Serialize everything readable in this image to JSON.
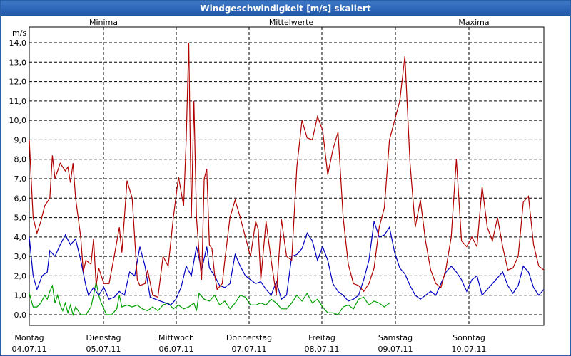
{
  "window": {
    "title": "Windgeschwindigkeit [m/s] skaliert"
  },
  "chart_data": {
    "type": "line",
    "title": "Windgeschwindigkeit [m/s] skaliert",
    "ylabel": "m/s",
    "ylim": [
      0,
      14
    ],
    "grid": true,
    "y_ticks": [
      "0,0",
      "1,0",
      "2,0",
      "3,0",
      "4,0",
      "5,0",
      "6,0",
      "7,0",
      "8,0",
      "9,0",
      "10,0",
      "11,0",
      "12,0",
      "13,0",
      "14,0"
    ],
    "x_ticks": [
      {
        "day": "Montag",
        "date": "04.07.11"
      },
      {
        "day": "Dienstag",
        "date": "05.07.11"
      },
      {
        "day": "Mittwoch",
        "date": "06.07.11"
      },
      {
        "day": "Donnerstag",
        "date": "07.07.11"
      },
      {
        "day": "Freitag",
        "date": "08.07.11"
      },
      {
        "day": "Samstag",
        "date": "09.07.11"
      },
      {
        "day": "Sonntag",
        "date": "10.07.11"
      }
    ],
    "x_range": [
      0,
      7
    ],
    "legend_placement": "top",
    "series": [
      {
        "name": "Minima",
        "color": "#00a000",
        "values": [
          [
            0.0,
            1.1
          ],
          [
            0.15,
            0.4
          ],
          [
            0.3,
            0.4
          ],
          [
            0.45,
            0.6
          ],
          [
            0.6,
            1.0
          ],
          [
            0.7,
            0.8
          ],
          [
            0.8,
            1.2
          ],
          [
            0.9,
            1.5
          ],
          [
            1.0,
            0.6
          ],
          [
            1.1,
            1.0
          ],
          [
            1.2,
            0.5
          ],
          [
            1.3,
            0.2
          ],
          [
            1.4,
            0.6
          ],
          [
            1.5,
            0.1
          ],
          [
            1.6,
            0.5
          ],
          [
            1.7,
            0.0
          ],
          [
            1.8,
            0.4
          ],
          [
            2.0,
            0.0
          ],
          [
            2.2,
            0.0
          ],
          [
            2.4,
            0.4
          ],
          [
            2.5,
            1.0
          ],
          [
            2.6,
            1.7
          ],
          [
            2.7,
            1.0
          ],
          [
            2.8,
            0.6
          ],
          [
            3.0,
            0.0
          ],
          [
            3.2,
            0.0
          ],
          [
            3.4,
            0.3
          ],
          [
            3.5,
            1.0
          ],
          [
            3.6,
            0.4
          ],
          [
            3.8,
            0.5
          ],
          [
            4.0,
            0.4
          ],
          [
            4.2,
            0.5
          ],
          [
            4.4,
            0.3
          ],
          [
            4.6,
            0.2
          ],
          [
            4.8,
            0.4
          ],
          [
            5.0,
            0.2
          ],
          [
            5.2,
            0.5
          ],
          [
            5.4,
            0.6
          ],
          [
            5.6,
            0.3
          ],
          [
            5.8,
            0.5
          ],
          [
            6.0,
            0.3
          ],
          [
            6.2,
            0.4
          ],
          [
            6.4,
            0.6
          ],
          [
            6.5,
            0.2
          ],
          [
            6.6,
            1.1
          ],
          [
            6.8,
            0.8
          ],
          [
            7.0,
            0.7
          ],
          [
            7.2,
            1.0
          ],
          [
            7.4,
            0.5
          ],
          [
            7.6,
            0.7
          ],
          [
            7.8,
            0.3
          ],
          [
            8.0,
            0.6
          ],
          [
            8.2,
            1.0
          ],
          [
            8.4,
            0.9
          ],
          [
            8.6,
            0.5
          ],
          [
            8.8,
            0.5
          ],
          [
            9.0,
            0.6
          ],
          [
            9.2,
            0.5
          ],
          [
            9.4,
            0.8
          ],
          [
            9.6,
            0.6
          ],
          [
            9.8,
            0.3
          ],
          [
            10.0,
            0.3
          ],
          [
            10.2,
            0.6
          ],
          [
            10.4,
            1.0
          ],
          [
            10.6,
            0.7
          ],
          [
            10.8,
            1.1
          ],
          [
            11.0,
            0.6
          ],
          [
            11.2,
            0.8
          ],
          [
            11.4,
            0.4
          ],
          [
            11.6,
            0.1
          ],
          [
            11.8,
            0.1
          ],
          [
            12.0,
            0.0
          ],
          [
            12.2,
            0.4
          ],
          [
            12.4,
            0.5
          ],
          [
            12.6,
            0.3
          ],
          [
            12.8,
            0.8
          ],
          [
            13.0,
            0.9
          ],
          [
            13.2,
            0.5
          ],
          [
            13.4,
            0.7
          ],
          [
            13.6,
            0.6
          ],
          [
            13.8,
            0.4
          ],
          [
            14.0,
            0.6
          ]
        ]
      },
      {
        "name": "Mittelwerte",
        "color": "#0000c0",
        "values": [
          [
            0.0,
            4.0
          ],
          [
            0.15,
            2.0
          ],
          [
            0.3,
            1.3
          ],
          [
            0.5,
            2.0
          ],
          [
            0.7,
            2.2
          ],
          [
            0.8,
            3.3
          ],
          [
            1.0,
            3.0
          ],
          [
            1.2,
            3.6
          ],
          [
            1.4,
            4.1
          ],
          [
            1.6,
            3.6
          ],
          [
            1.8,
            3.9
          ],
          [
            2.0,
            2.8
          ],
          [
            2.2,
            1.5
          ],
          [
            2.3,
            1.0
          ],
          [
            2.5,
            1.4
          ],
          [
            2.7,
            1.0
          ],
          [
            2.9,
            1.4
          ],
          [
            3.1,
            0.8
          ],
          [
            3.3,
            0.9
          ],
          [
            3.5,
            1.2
          ],
          [
            3.7,
            1.0
          ],
          [
            3.9,
            2.2
          ],
          [
            4.1,
            2.0
          ],
          [
            4.3,
            3.5
          ],
          [
            4.5,
            2.5
          ],
          [
            4.7,
            0.9
          ],
          [
            4.9,
            0.8
          ],
          [
            5.1,
            0.7
          ],
          [
            5.3,
            0.6
          ],
          [
            5.5,
            0.5
          ],
          [
            5.7,
            0.8
          ],
          [
            5.9,
            1.4
          ],
          [
            6.1,
            2.5
          ],
          [
            6.3,
            2.0
          ],
          [
            6.5,
            3.5
          ],
          [
            6.7,
            2.3
          ],
          [
            6.9,
            3.5
          ],
          [
            7.0,
            2.4
          ],
          [
            7.2,
            2.0
          ],
          [
            7.4,
            1.5
          ],
          [
            7.6,
            1.4
          ],
          [
            7.8,
            1.6
          ],
          [
            8.0,
            3.1
          ],
          [
            8.2,
            2.5
          ],
          [
            8.4,
            2.0
          ],
          [
            8.6,
            1.8
          ],
          [
            8.8,
            1.6
          ],
          [
            9.0,
            1.7
          ],
          [
            9.2,
            1.3
          ],
          [
            9.4,
            1.0
          ],
          [
            9.6,
            1.7
          ],
          [
            9.8,
            0.8
          ],
          [
            10.0,
            1.0
          ],
          [
            10.2,
            3.0
          ],
          [
            10.4,
            3.1
          ],
          [
            10.6,
            3.4
          ],
          [
            10.8,
            4.2
          ],
          [
            11.0,
            3.8
          ],
          [
            11.2,
            2.8
          ],
          [
            11.4,
            3.5
          ],
          [
            11.6,
            2.8
          ],
          [
            11.8,
            1.6
          ],
          [
            12.0,
            1.2
          ],
          [
            12.2,
            1.0
          ],
          [
            12.4,
            0.7
          ],
          [
            12.6,
            0.8
          ],
          [
            12.8,
            1.0
          ],
          [
            13.0,
            1.8
          ],
          [
            13.2,
            2.8
          ],
          [
            13.4,
            4.8
          ],
          [
            13.6,
            4.0
          ],
          [
            13.8,
            4.1
          ],
          [
            14.0,
            4.5
          ],
          [
            14.2,
            3.2
          ],
          [
            14.4,
            2.4
          ],
          [
            14.6,
            2.1
          ],
          [
            14.8,
            1.5
          ],
          [
            15.0,
            1.0
          ],
          [
            15.2,
            0.8
          ],
          [
            15.4,
            1.0
          ],
          [
            15.6,
            1.2
          ],
          [
            15.8,
            1.0
          ],
          [
            16.0,
            1.6
          ],
          [
            16.2,
            2.2
          ],
          [
            16.4,
            2.5
          ],
          [
            16.6,
            2.2
          ],
          [
            16.8,
            1.8
          ],
          [
            17.0,
            1.2
          ],
          [
            17.2,
            1.8
          ],
          [
            17.4,
            2.0
          ],
          [
            17.6,
            1.0
          ],
          [
            17.8,
            1.3
          ],
          [
            18.0,
            1.6
          ],
          [
            18.2,
            1.9
          ],
          [
            18.4,
            2.2
          ],
          [
            18.6,
            1.5
          ],
          [
            18.8,
            1.1
          ],
          [
            19.0,
            1.5
          ],
          [
            19.2,
            2.5
          ],
          [
            19.4,
            2.2
          ],
          [
            19.6,
            1.4
          ],
          [
            19.8,
            1.0
          ],
          [
            20.0,
            1.3
          ]
        ]
      },
      {
        "name": "Maxima",
        "color": "#b00000",
        "values": [
          [
            0.0,
            9.0
          ],
          [
            0.15,
            5.0
          ],
          [
            0.3,
            4.2
          ],
          [
            0.45,
            4.8
          ],
          [
            0.6,
            5.6
          ],
          [
            0.8,
            6.0
          ],
          [
            0.9,
            8.2
          ],
          [
            1.0,
            7.0
          ],
          [
            1.2,
            7.8
          ],
          [
            1.4,
            7.4
          ],
          [
            1.5,
            7.6
          ],
          [
            1.6,
            6.8
          ],
          [
            1.7,
            7.8
          ],
          [
            1.8,
            6.0
          ],
          [
            2.0,
            4.0
          ],
          [
            2.1,
            2.2
          ],
          [
            2.2,
            2.8
          ],
          [
            2.4,
            2.6
          ],
          [
            2.5,
            3.9
          ],
          [
            2.6,
            1.5
          ],
          [
            2.7,
            2.4
          ],
          [
            2.9,
            1.6
          ],
          [
            3.1,
            1.6
          ],
          [
            3.3,
            3.0
          ],
          [
            3.5,
            4.5
          ],
          [
            3.6,
            3.2
          ],
          [
            3.8,
            6.9
          ],
          [
            4.0,
            6.0
          ],
          [
            4.2,
            1.8
          ],
          [
            4.3,
            1.5
          ],
          [
            4.5,
            1.6
          ],
          [
            4.6,
            2.3
          ],
          [
            4.8,
            1.0
          ],
          [
            5.0,
            0.9
          ],
          [
            5.2,
            3.0
          ],
          [
            5.4,
            2.5
          ],
          [
            5.6,
            5.0
          ],
          [
            5.8,
            7.1
          ],
          [
            6.0,
            5.6
          ],
          [
            6.1,
            9.0
          ],
          [
            6.2,
            14.0
          ],
          [
            6.3,
            5.0
          ],
          [
            6.4,
            11.0
          ],
          [
            6.5,
            5.0
          ],
          [
            6.6,
            3.2
          ],
          [
            6.7,
            1.8
          ],
          [
            6.8,
            7.0
          ],
          [
            6.9,
            7.5
          ],
          [
            7.0,
            3.6
          ],
          [
            7.1,
            3.4
          ],
          [
            7.2,
            2.1
          ],
          [
            7.3,
            1.3
          ],
          [
            7.5,
            1.6
          ],
          [
            7.6,
            2.8
          ],
          [
            7.8,
            5.0
          ],
          [
            8.0,
            5.9
          ],
          [
            8.2,
            5.0
          ],
          [
            8.4,
            4.0
          ],
          [
            8.6,
            3.0
          ],
          [
            8.8,
            4.8
          ],
          [
            8.9,
            4.4
          ],
          [
            9.0,
            1.8
          ],
          [
            9.2,
            4.8
          ],
          [
            9.4,
            2.8
          ],
          [
            9.6,
            1.0
          ],
          [
            9.8,
            4.9
          ],
          [
            10.0,
            3.0
          ],
          [
            10.2,
            2.8
          ],
          [
            10.4,
            7.6
          ],
          [
            10.6,
            10.0
          ],
          [
            10.8,
            9.1
          ],
          [
            11.0,
            9.0
          ],
          [
            11.2,
            10.2
          ],
          [
            11.4,
            9.5
          ],
          [
            11.6,
            7.2
          ],
          [
            11.8,
            8.5
          ],
          [
            12.0,
            9.4
          ],
          [
            12.2,
            5.0
          ],
          [
            12.4,
            2.6
          ],
          [
            12.6,
            1.6
          ],
          [
            12.8,
            1.5
          ],
          [
            13.0,
            1.2
          ],
          [
            13.2,
            1.6
          ],
          [
            13.4,
            2.4
          ],
          [
            13.6,
            4.5
          ],
          [
            13.8,
            5.5
          ],
          [
            14.0,
            9.0
          ],
          [
            14.2,
            10.0
          ],
          [
            14.4,
            11.0
          ],
          [
            14.6,
            13.3
          ],
          [
            14.8,
            7.8
          ],
          [
            15.0,
            4.5
          ],
          [
            15.2,
            5.9
          ],
          [
            15.4,
            3.8
          ],
          [
            15.6,
            2.3
          ],
          [
            15.8,
            1.6
          ],
          [
            16.0,
            1.4
          ],
          [
            16.2,
            2.4
          ],
          [
            16.4,
            4.0
          ],
          [
            16.6,
            8.0
          ],
          [
            16.8,
            3.8
          ],
          [
            17.0,
            3.5
          ],
          [
            17.2,
            4.0
          ],
          [
            17.4,
            3.5
          ],
          [
            17.6,
            6.6
          ],
          [
            17.8,
            4.5
          ],
          [
            18.0,
            3.8
          ],
          [
            18.2,
            5.0
          ],
          [
            18.4,
            3.5
          ],
          [
            18.6,
            2.3
          ],
          [
            18.8,
            2.4
          ],
          [
            19.0,
            3.0
          ],
          [
            19.2,
            5.8
          ],
          [
            19.4,
            6.1
          ],
          [
            19.6,
            3.6
          ],
          [
            19.8,
            2.5
          ],
          [
            20.0,
            2.3
          ]
        ]
      }
    ]
  }
}
